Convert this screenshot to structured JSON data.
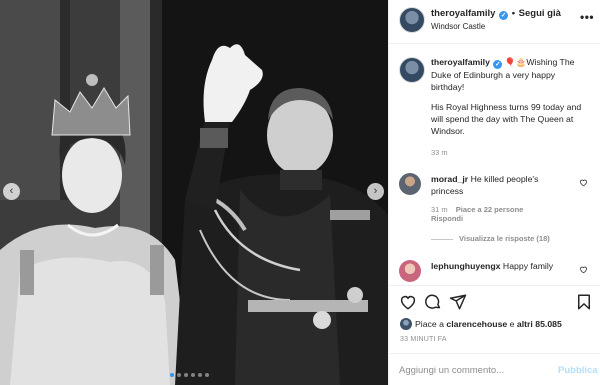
{
  "post": {
    "username": "theroyalfamily",
    "follow_label": "Segui già",
    "location": "Windsor Castle",
    "more_label": "•••"
  },
  "caption": {
    "username": "theroyalfamily",
    "emoji": "🎈🎂",
    "line1": "Wishing The Duke of Edinburgh a very happy birthday!",
    "line2": "His Royal Highness turns 99 today and will spend the day with The Queen at Windsor.",
    "time": "33 m"
  },
  "comments": [
    {
      "username": "morad_jr",
      "text": "He killed people's princess",
      "time": "31 m",
      "likes": "Piace a 22 persone",
      "reply": "Rispondi",
      "view_replies": "Visualizza le risposte (18)"
    },
    {
      "username": "lephunghuyengx",
      "text": "Happy family"
    }
  ],
  "likes": {
    "prefix": "Piace a ",
    "user": "clarencehouse",
    "middle": " e ",
    "others": "altri 85.085"
  },
  "timestamp": "33 MINUTI FA",
  "composer": {
    "placeholder": "Aggiungi un commento...",
    "publish_label": "Pubblica"
  },
  "carousel": {
    "slide_count": 6,
    "active_index": 0
  },
  "icons": {
    "verified": "verified-badge-icon",
    "like": "heart-icon",
    "comment": "comment-bubble-icon",
    "share": "paper-plane-icon",
    "save": "bookmark-icon",
    "prev": "chevron-left-icon",
    "next": "chevron-right-icon"
  },
  "colors": {
    "verified": "#3897f0",
    "muted": "#8e8e8e",
    "publish_disabled": "#b2dffc",
    "active_dot": "#2f94f0"
  }
}
